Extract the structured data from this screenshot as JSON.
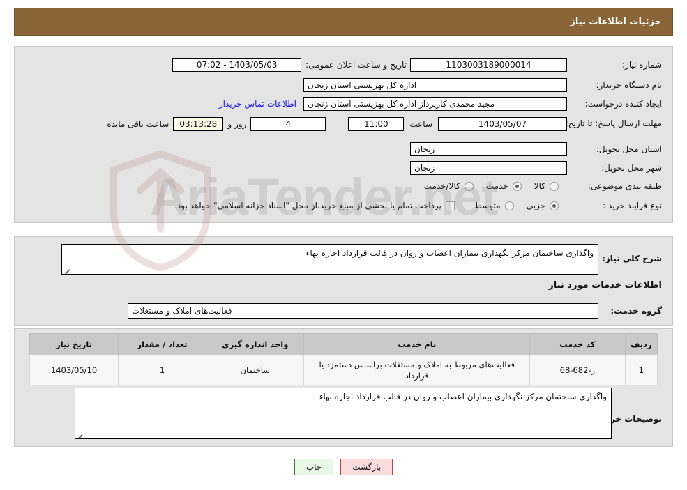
{
  "header": {
    "title": "جزئیات اطلاعات نیاز"
  },
  "watermark": {
    "text_main": "AriaTender",
    "text_suffix": ".net"
  },
  "top_panel": {
    "need_number_label": "شماره نیاز:",
    "need_number_value": "1103003189000014",
    "announce_datetime_label": "تاریخ و ساعت اعلان عمومی:",
    "announce_datetime_value": "1403/05/03 - 07:02",
    "buyer_org_label": "نام دستگاه خریدار:",
    "buyer_org_value": "اداره کل بهزیستی استان زنجان",
    "request_creator_label": "ایجاد کننده درخواست:",
    "request_creator_value": "مجید محمدی کارپرداز اداره کل بهزیستی استان زنجان",
    "buyer_contact_link": "اطلاعات تماس خریدار",
    "deadline_label": "مهلت ارسال پاسخ: تا تاریخ:",
    "deadline_date_value": "1403/05/07",
    "hour_label": "ساعت",
    "deadline_time_value": "11:00",
    "days_remaining_value": "4",
    "day_and_label": "روز و",
    "countdown_value": "03:13:28",
    "hours_remaining_label": "ساعت باقی مانده",
    "delivery_province_label": "استان محل تحویل:",
    "delivery_province_value": "زنجان",
    "delivery_city_label": "شهر محل تحویل:",
    "delivery_city_value": "زنجان",
    "category_label": "طبقه بندی موضوعی:",
    "category_options": [
      {
        "label": "کالا",
        "selected": false
      },
      {
        "label": "خدمت",
        "selected": true
      },
      {
        "label": "کالا/خدمت",
        "selected": false
      }
    ],
    "process_type_label": "نوع فرآیند خرید :",
    "process_options": [
      {
        "label": "جزیی",
        "selected": true
      },
      {
        "label": "متوسط",
        "selected": false
      }
    ],
    "payment_checkbox_label": "پرداخت تمام یا بخشی از مبلغ خرید،از محل \"اسناد خزانه اسلامی\" خواهد بود.",
    "payment_checkbox_checked": false
  },
  "mid_panel": {
    "general_desc_label": "شرح کلی نیاز:",
    "general_desc_value": "واگذاری ساختمان مرکز نگهداری بیماران اعصاب و روان در قالب قرارداد اجاره بهاء",
    "services_info_heading": "اطلاعات خدمات مورد نیاز",
    "service_group_label": "گروه خدمت:",
    "service_group_value": "فعالیت‌های  املاک و مستغلات"
  },
  "table": {
    "headers": [
      "ردیف",
      "کد خدمت",
      "نام خدمت",
      "واحد اندازه گیری",
      "تعداد / مقدار",
      "تاریخ نیاز"
    ],
    "rows": [
      {
        "index": "1",
        "code": "ر-682-68",
        "name": "فعالیت‌های مربوط به املاک و مستغلات براساس دستمزد یا قرارداد",
        "unit": "ساختمان",
        "quantity": "1",
        "need_date": "1403/05/10"
      }
    ]
  },
  "bottom_panel": {
    "buyer_notes_label": "توضیحات خریدار:",
    "buyer_notes_value": "واگذاری ساختمان مرکز نگهداری بیماران اعصاب و روان در قالب قرارداد اجاره بهاء"
  },
  "footer": {
    "print_label": "چاپ",
    "back_label": "بازگشت"
  },
  "colors": {
    "header_bar": "#8a6538",
    "panel_bg": "#e4e4e4",
    "link": "#1313e0",
    "table_header": "#c9c9c9",
    "print_btn": "#e9f7e6",
    "back_btn": "#fadcdc",
    "timer_bg": "#fbfae6"
  }
}
